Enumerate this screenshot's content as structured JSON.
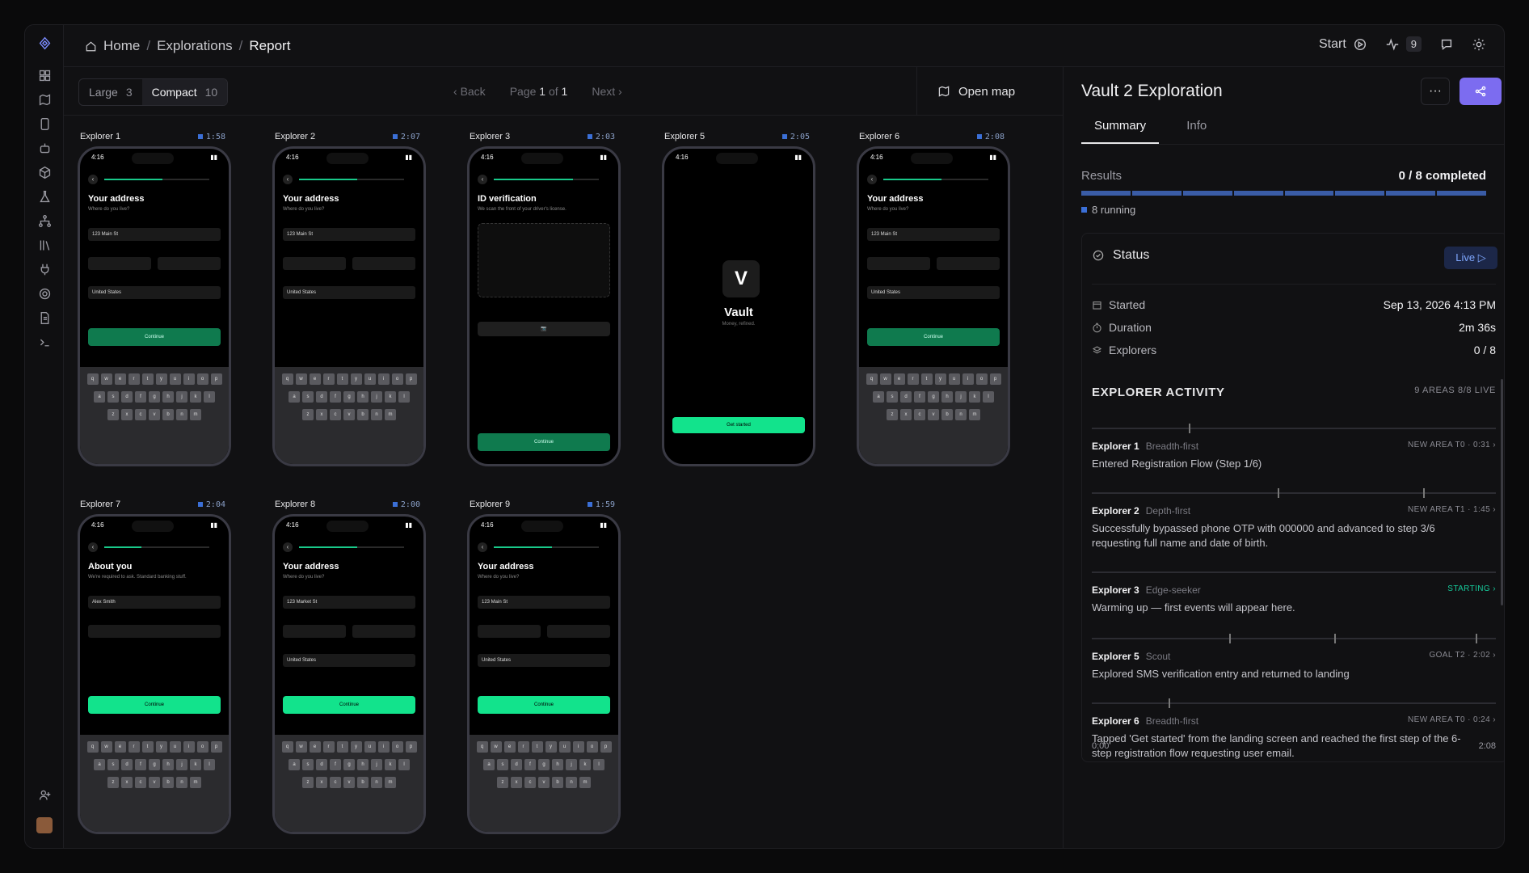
{
  "breadcrumb": {
    "home": "Home",
    "sep": "/",
    "explorations": "Explorations",
    "report": "Report"
  },
  "topbar": {
    "start": "Start",
    "activity_count": "9"
  },
  "toolbar": {
    "large": "Large",
    "large_count": "3",
    "compact": "Compact",
    "compact_count": "10",
    "back": "Back",
    "page_word": "Page",
    "page": "1",
    "of_word": "of",
    "total": "1",
    "next": "Next",
    "open_map": "Open map"
  },
  "cells": [
    {
      "name": "Explorer 1",
      "time": "1:58",
      "title": "Your address",
      "sub": "Where do you live?",
      "street": "123 Main St",
      "progress": 0.55,
      "keyboard": true,
      "button": "Continue"
    },
    {
      "name": "Explorer 2",
      "time": "2:07",
      "title": "Your address",
      "sub": "Where do you live?",
      "street": "123 Main St",
      "progress": 0.55,
      "keyboard": true,
      "button": ""
    },
    {
      "name": "Explorer 3",
      "time": "2:03",
      "title": "ID verification",
      "sub": "We scan the front of your driver's license.",
      "street": "",
      "progress": 0.75,
      "keyboard": false,
      "button": "Continue"
    },
    {
      "name": "Explorer 5",
      "time": "2:05",
      "title": "Vault",
      "sub": "Money, refined.",
      "street": "",
      "progress": 0,
      "keyboard": false,
      "button": "Get started"
    },
    {
      "name": "Explorer 6",
      "time": "2:08",
      "title": "Your address",
      "sub": "Where do you live?",
      "street": "123 Main St",
      "progress": 0.55,
      "keyboard": true,
      "button": "Continue"
    },
    {
      "name": "Explorer 7",
      "time": "2:04",
      "title": "About you",
      "sub": "We're required to ask. Standard banking stuff.",
      "street": "Alex Smith",
      "progress": 0.35,
      "keyboard": true,
      "button": "Continue"
    },
    {
      "name": "Explorer 8",
      "time": "2:00",
      "title": "Your address",
      "sub": "Where do you live?",
      "street": "123 Market St",
      "progress": 0.55,
      "keyboard": true,
      "button": "Continue"
    },
    {
      "name": "Explorer 9",
      "time": "1:59",
      "title": "Your address",
      "sub": "Where do you live?",
      "street": "123 Main St",
      "progress": 0.55,
      "keyboard": true,
      "button": "Continue"
    }
  ],
  "phone": {
    "clock": "4:16",
    "country": "United States"
  },
  "panel": {
    "title": "Vault 2 Exploration",
    "more": "···",
    "tabs": [
      "Summary",
      "Info"
    ],
    "results_label": "Results",
    "results_value": "0 / 8 completed",
    "running": "8 running",
    "status_label": "Status",
    "live": "Live ▷",
    "rows": [
      {
        "k": "Started",
        "v": "Sep 13, 2026 4:13 PM"
      },
      {
        "k": "Duration",
        "v": "2m 36s"
      },
      {
        "k": "Explorers",
        "v": "0 / 8"
      }
    ],
    "activity_title": "EXPLORER ACTIVITY",
    "activity_meta": "9 AREAS   8/8 LIVE",
    "activity": [
      {
        "name": "Explorer 1",
        "strategy": "Breadth-first",
        "meta": "NEW AREA   T0 · 0:31  ›",
        "desc": "Entered Registration Flow (Step 1/6)",
        "marks": [
          0.24
        ]
      },
      {
        "name": "Explorer 2",
        "strategy": "Depth-first",
        "meta": "NEW AREA   T1 · 1:45  ›",
        "desc": "Successfully bypassed phone OTP with 000000 and advanced to step 3/6 requesting full name and date of birth.",
        "marks": [
          0.46,
          0.82
        ]
      },
      {
        "name": "Explorer 3",
        "strategy": "Edge-seeker",
        "meta": "STARTING  ›",
        "desc": "Warming up — first events will appear here.",
        "marks": []
      },
      {
        "name": "Explorer 5",
        "strategy": "Scout",
        "meta": "GOAL   T2 · 2:02  ›",
        "desc": "Explored SMS verification entry and returned to landing",
        "marks": [
          0.34,
          0.6,
          0.95
        ]
      },
      {
        "name": "Explorer 6",
        "strategy": "Breadth-first",
        "meta": "NEW AREA   T0 · 0:24  ›",
        "desc": "Tapped 'Get started' from the landing screen and reached the first step of the 6-step registration flow requesting user email.",
        "marks": [
          0.19
        ]
      }
    ],
    "axis_start": "0:00",
    "axis_end": "2:08"
  }
}
